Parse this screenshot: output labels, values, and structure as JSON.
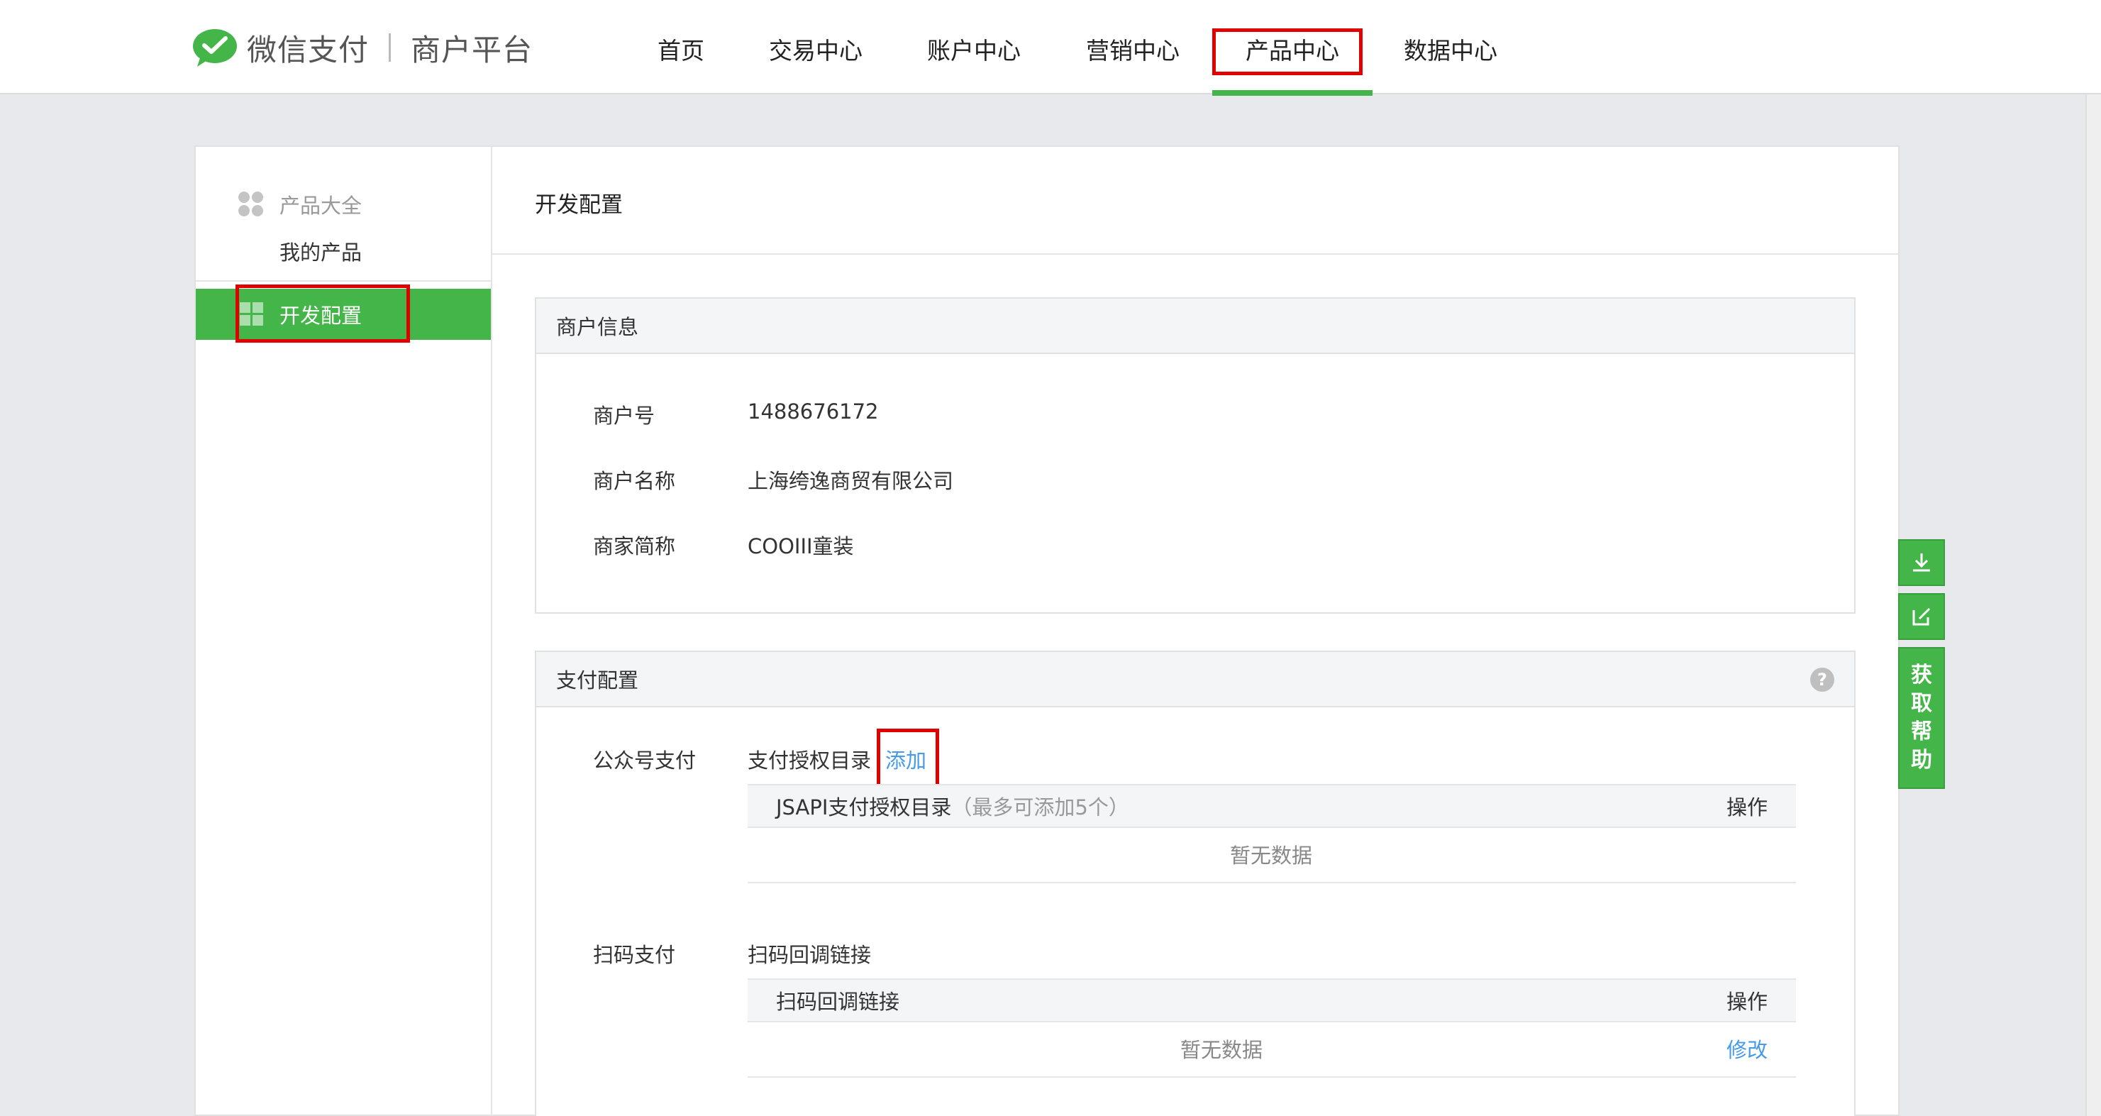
{
  "header": {
    "brand": "微信支付",
    "brand_sub": "商户平台",
    "nav": [
      {
        "label": "首页"
      },
      {
        "label": "交易中心"
      },
      {
        "label": "账户中心"
      },
      {
        "label": "营销中心"
      },
      {
        "label": "产品中心",
        "active": true
      },
      {
        "label": "数据中心"
      }
    ]
  },
  "sidebar": {
    "group_label": "产品大全",
    "sub_item": "我的产品",
    "active_item": "开发配置"
  },
  "main": {
    "page_title": "开发配置",
    "merchant_info": {
      "title": "商户信息",
      "rows": [
        {
          "label": "商户号",
          "value": "1488676172"
        },
        {
          "label": "商户名称",
          "value": "上海绔逸商贸有限公司"
        },
        {
          "label": "商家简称",
          "value": "COOIII童装"
        }
      ]
    },
    "pay_config": {
      "title": "支付配置",
      "help": "?",
      "jsapi": {
        "label": "公众号支付",
        "sub_label": "支付授权目录",
        "add_link": "添加",
        "table_col1": "JSAPI支付授权目录",
        "table_col1_hint": "（最多可添加5个）",
        "table_col2": "操作",
        "empty": "暂无数据"
      },
      "native": {
        "label": "扫码支付",
        "sub_label": "扫码回调链接",
        "table_col1": "扫码回调链接",
        "table_col2": "操作",
        "empty": "暂无数据",
        "edit_link": "修改"
      }
    }
  },
  "tools": {
    "help_chars": [
      "获",
      "取",
      "帮",
      "助"
    ]
  },
  "colors": {
    "brand_green": "#44b549",
    "highlight_red": "#e00000",
    "link_blue": "#459ae9"
  }
}
